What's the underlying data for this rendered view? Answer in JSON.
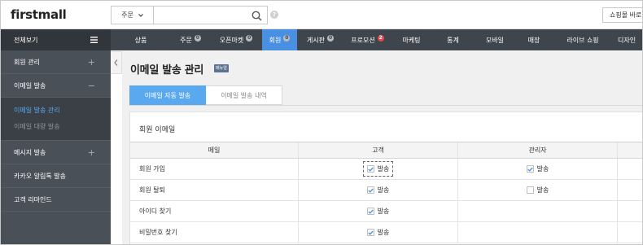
{
  "header": {
    "logo": "firstmall",
    "search_select": "주문",
    "search_placeholder": "",
    "help_label": "?",
    "shop_button": "쇼핑몰 바로가기"
  },
  "sidebar": {
    "title": "전체보기",
    "items": [
      {
        "label": "회원 관리",
        "sign": "+"
      },
      {
        "label": "이메일 발송",
        "sign": "−"
      },
      {
        "label": "메시지 발송",
        "sign": "+"
      },
      {
        "label": "카카오 알림톡 발송",
        "sign": ""
      },
      {
        "label": "고객 리마인드",
        "sign": ""
      }
    ],
    "sub_items": [
      {
        "label": "이메일 발송 관리",
        "active": true
      },
      {
        "label": "이메일 대량 발송",
        "active": false
      }
    ]
  },
  "nav": {
    "items": [
      {
        "label": "상품",
        "badge": ""
      },
      {
        "label": "주문",
        "badge": "0"
      },
      {
        "label": "오픈마켓",
        "badge": "0"
      },
      {
        "label": "회원",
        "badge": "0",
        "active": true
      },
      {
        "label": "게시판",
        "badge": "0"
      },
      {
        "label": "프로모션",
        "badge": "2",
        "badge_color": "#e9474b"
      },
      {
        "label": "마케팅",
        "badge": ""
      },
      {
        "label": "통계",
        "badge": ""
      },
      {
        "label": "모바일",
        "badge": ""
      },
      {
        "label": "매장",
        "badge": ""
      },
      {
        "label": "라이브 쇼핑",
        "badge": ""
      },
      {
        "label": "디자인",
        "badge": ""
      }
    ]
  },
  "page": {
    "title": "이메일 발송 관리",
    "manual_tag": "매뉴얼",
    "tabs": [
      {
        "label": "이메일 자동 발송",
        "active": true
      },
      {
        "label": "이메일 발송 내역",
        "active": false
      }
    ]
  },
  "panel": {
    "title": "회원 이메일",
    "columns": [
      "메일",
      "고객",
      "관리자",
      ""
    ],
    "check_label": "발송",
    "rows": [
      {
        "name": "회원 가입",
        "customer": true,
        "admin": true
      },
      {
        "name": "회원 탈퇴",
        "customer": true,
        "admin": false
      },
      {
        "name": "아이디 찾기",
        "customer": true,
        "admin": null
      },
      {
        "name": "비밀번호 찾기",
        "customer": true,
        "admin": null
      }
    ]
  },
  "colors": {
    "accent": "#4a90e2",
    "sidebar_bg": "#495058",
    "nav_bg": "#3f454c",
    "tab_active": "#5aa9f0",
    "badge_red": "#e9474b"
  }
}
